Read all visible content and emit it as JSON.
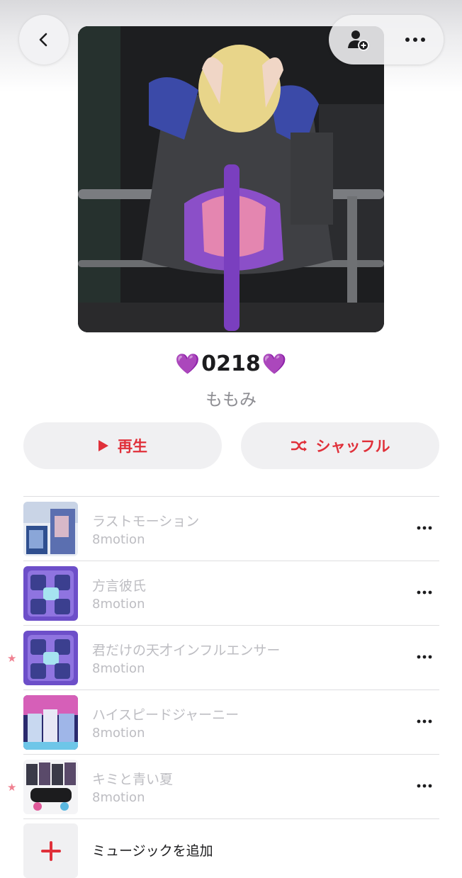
{
  "header": {
    "back_icon": "chevron-left-icon",
    "add_friend_icon": "person-add-icon",
    "more_icon": "ellipsis-icon"
  },
  "playlist": {
    "title": "0218",
    "title_emoji_left": "💜",
    "title_emoji_right": "💜",
    "curator": "ももみ"
  },
  "controls": {
    "play_label": "再生",
    "shuffle_label": "シャッフル",
    "accent_color": "#e0303a"
  },
  "tracks": [
    {
      "title": "ラストモーション",
      "artist": "8motion",
      "starred": false
    },
    {
      "title": "方言彼氏",
      "artist": "8motion",
      "starred": false
    },
    {
      "title": "君だけの天才インフルエンサー",
      "artist": "8motion",
      "starred": true
    },
    {
      "title": "ハイスピードジャーニー",
      "artist": "8motion",
      "starred": false
    },
    {
      "title": "キミと青い夏",
      "artist": "8motion",
      "starred": true
    }
  ],
  "add_music_label": "ミュージックを追加",
  "star_glyph": "★"
}
